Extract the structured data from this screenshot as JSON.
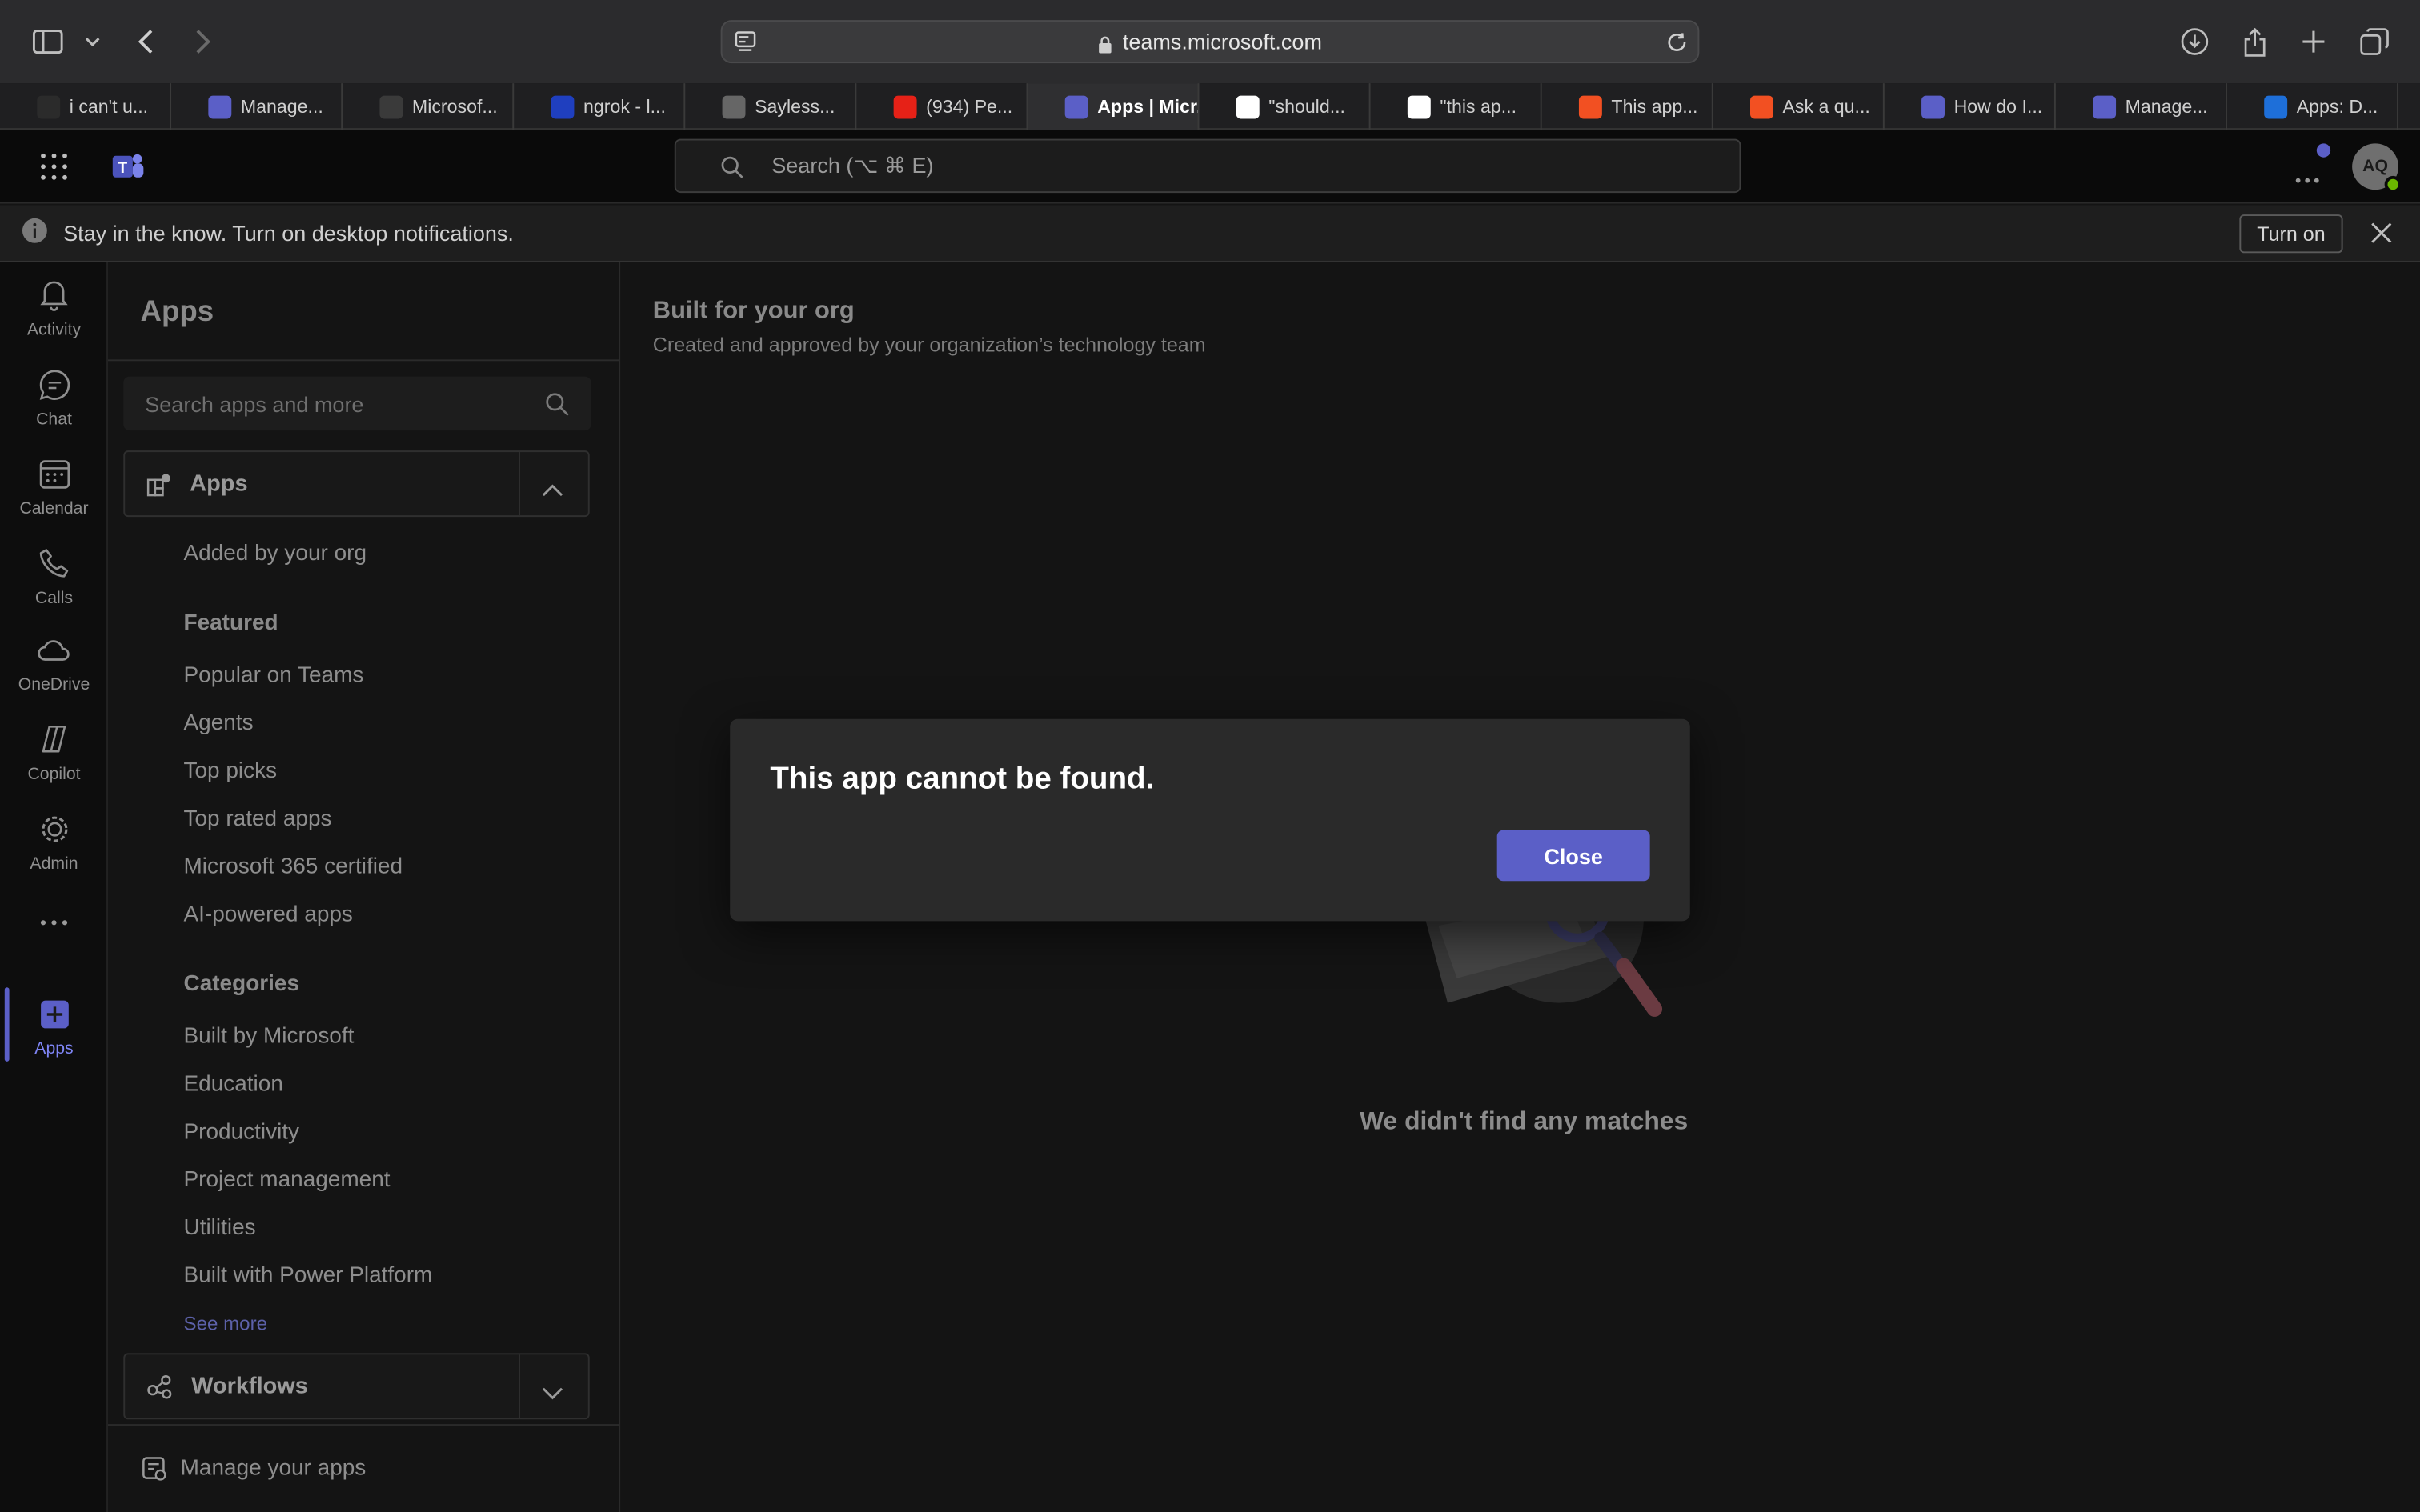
{
  "browser": {
    "url": "teams.microsoft.com",
    "tabs": [
      {
        "label": "i can't u...",
        "favicon": "spider-icon",
        "color": "#2b2b2b"
      },
      {
        "label": "Manage...",
        "favicon": "teams-icon",
        "color": "#5b5fc7"
      },
      {
        "label": "Microsof...",
        "favicon": "layers-icon",
        "color": "#3a3a3a"
      },
      {
        "label": "ngrok - l...",
        "favicon": "ngrok-icon",
        "color": "#1f3fbf"
      },
      {
        "label": "Sayless...",
        "favicon": "a-icon",
        "color": "#666666"
      },
      {
        "label": "(934) Pe...",
        "favicon": "youtube-icon",
        "color": "#e62117"
      },
      {
        "label": "Apps | Micr...",
        "favicon": "teams-icon",
        "color": "#5b5fc7",
        "active": true
      },
      {
        "label": "\"should...",
        "favicon": "google-icon",
        "color": "#ffffff"
      },
      {
        "label": "\"this ap...",
        "favicon": "google-icon",
        "color": "#ffffff"
      },
      {
        "label": "This app...",
        "favicon": "microsoft-icon",
        "color": "#f25022"
      },
      {
        "label": "Ask a qu...",
        "favicon": "microsoft-icon",
        "color": "#f25022"
      },
      {
        "label": "How do I...",
        "favicon": "bing-icon",
        "color": "#5b5fc7"
      },
      {
        "label": "Manage...",
        "favicon": "teams-icon",
        "color": "#5b5fc7"
      },
      {
        "label": "Apps: D...",
        "favicon": "powerapps-icon",
        "color": "#1e6fd9"
      }
    ]
  },
  "header": {
    "search_placeholder": "Search (⌥ ⌘ E)",
    "avatar_initials": "AQ"
  },
  "notification": {
    "text": "Stay in the know. Turn on desktop notifications.",
    "button": "Turn on"
  },
  "rail": {
    "items": [
      {
        "label": "Activity",
        "icon": "bell-icon"
      },
      {
        "label": "Chat",
        "icon": "chat-icon"
      },
      {
        "label": "Calendar",
        "icon": "calendar-icon"
      },
      {
        "label": "Calls",
        "icon": "phone-icon"
      },
      {
        "label": "OneDrive",
        "icon": "cloud-icon"
      },
      {
        "label": "Copilot",
        "icon": "copilot-icon"
      },
      {
        "label": "Admin",
        "icon": "admin-icon"
      },
      {
        "label": "Apps",
        "icon": "apps-plus-icon",
        "active": true
      }
    ]
  },
  "sidebar": {
    "title": "Apps",
    "search_placeholder": "Search apps and more",
    "apps_group": "Apps",
    "added_by_org": "Added by your org",
    "featured_heading": "Featured",
    "featured": [
      "Popular on Teams",
      "Agents",
      "Top picks",
      "Top rated apps",
      "Microsoft 365 certified",
      "AI-powered apps"
    ],
    "categories_heading": "Categories",
    "categories": [
      "Built by Microsoft",
      "Education",
      "Productivity",
      "Project management",
      "Utilities",
      "Built with Power Platform"
    ],
    "see_more": "See more",
    "workflows_group": "Workflows",
    "manage": "Manage your apps"
  },
  "main": {
    "title": "Built for your org",
    "subtitle": "Created and approved by your organization’s technology team",
    "empty": "We didn't find any matches"
  },
  "dialog": {
    "title": "This app cannot be found.",
    "close": "Close"
  },
  "colors": {
    "accent": "#5b5fc7"
  }
}
